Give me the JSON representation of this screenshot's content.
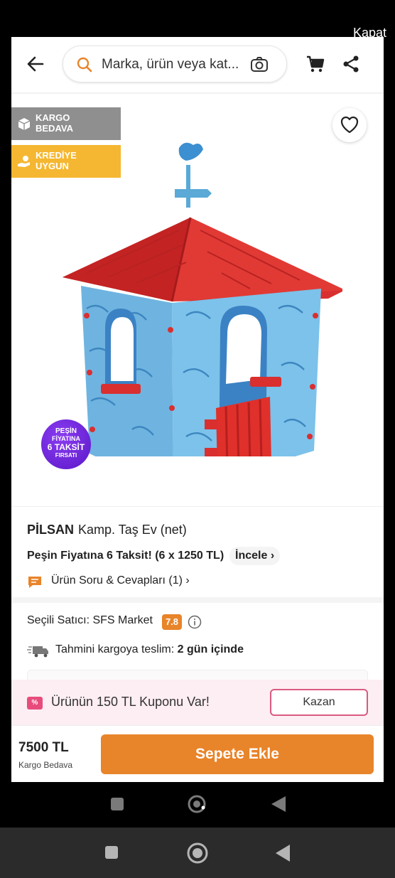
{
  "overlay": {
    "close_label": "Kapat"
  },
  "header": {
    "search_placeholder": "Marka, ürün veya kat..."
  },
  "badges": {
    "kargo": "KARGO BEDAVA",
    "kredi": "KREDİYE UYGUN"
  },
  "promo": {
    "line1": "PEŞİN",
    "line2": "FİYATINA",
    "line3": "6 TAKSİT",
    "line4": "FIRSATI"
  },
  "product": {
    "brand": "PİLSAN",
    "name": "Kamp. Taş Ev (net)",
    "installment": "Peşin Fiyatına 6 Taksit! (6 x 1250 TL)",
    "incele": "İncele",
    "qa": "Ürün Soru & Cevapları (1)"
  },
  "seller": {
    "label": "Seçili Satıcı: SFS Market",
    "score": "7.8",
    "shipping_prefix": "Tahmini kargoya teslim:",
    "shipping_value": "2 gün içinde"
  },
  "coupon": {
    "icon_text": "%",
    "text": "Ürünün 150 TL Kuponu Var!",
    "button": "Kazan"
  },
  "bottom": {
    "price": "7500 TL",
    "shipping": "Kargo Bedava",
    "add_to_cart": "Sepete Ekle"
  },
  "colors": {
    "accent": "#e8842a",
    "coupon_bg": "#fdeef3",
    "coupon_border": "#d95a80",
    "kargo_badge": "#8f8f8f",
    "kredi_badge": "#f5b731"
  }
}
